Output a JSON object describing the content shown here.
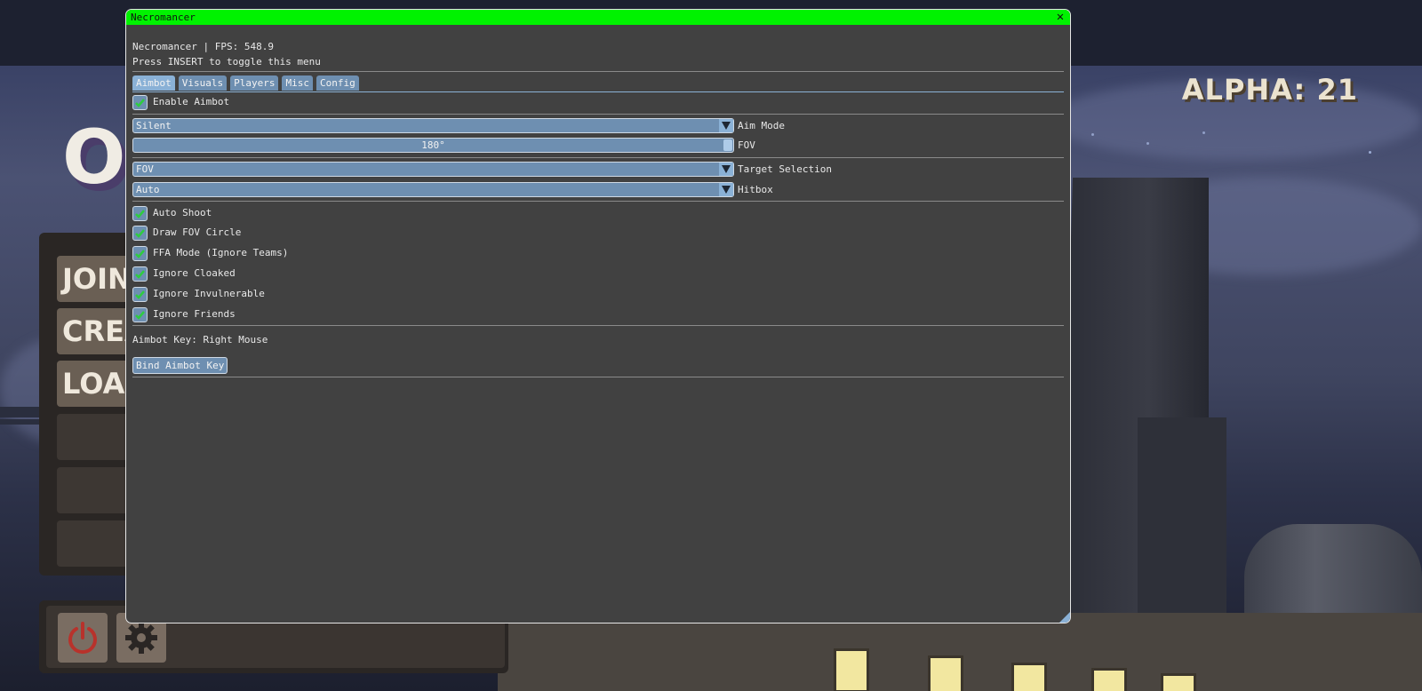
{
  "background": {
    "logo_fragment": "OP",
    "alpha_label": "ALPHA: 21",
    "menu_buttons": [
      "JOIN",
      "CREA",
      "LOAD"
    ]
  },
  "window": {
    "title": "Necromancer",
    "header_line": "Necromancer | FPS: 548.9",
    "hint_line": "Press INSERT to toggle this menu",
    "tabs": [
      {
        "label": "Aimbot",
        "active": true
      },
      {
        "label": "Visuals",
        "active": false
      },
      {
        "label": "Players",
        "active": false
      },
      {
        "label": "Misc",
        "active": false
      },
      {
        "label": "Config",
        "active": false
      }
    ],
    "enable_aimbot": {
      "label": "Enable Aimbot",
      "checked": true
    },
    "aim_mode": {
      "value": "Silent",
      "label": "Aim Mode"
    },
    "fov": {
      "value": "180°",
      "label": "FOV",
      "fraction": 1.0
    },
    "target_selection": {
      "value": "FOV",
      "label": "Target Selection"
    },
    "hitbox": {
      "value": "Auto",
      "label": "Hitbox"
    },
    "options": [
      {
        "label": "Auto Shoot",
        "checked": true
      },
      {
        "label": "Draw FOV Circle",
        "checked": true
      },
      {
        "label": "FFA Mode (Ignore Teams)",
        "checked": true
      },
      {
        "label": "Ignore Cloaked",
        "checked": true
      },
      {
        "label": "Ignore Invulnerable",
        "checked": true
      },
      {
        "label": "Ignore Friends",
        "checked": true
      }
    ],
    "aimbot_key_text": "Aimbot Key: Right Mouse",
    "bind_button": "Bind Aimbot Key"
  },
  "colors": {
    "titlebar": "#00f200",
    "window_bg": "#414141",
    "widget": "#6e8fb1",
    "check_mark": "#2ecc40",
    "power_icon": "#b8322b"
  }
}
